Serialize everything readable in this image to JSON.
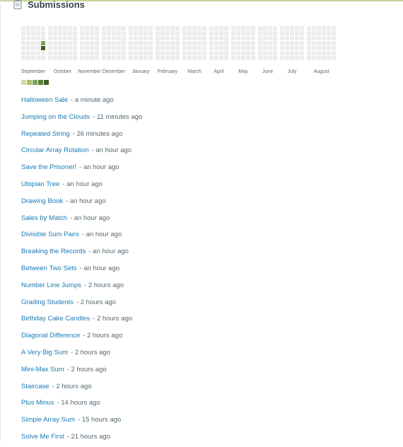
{
  "section": {
    "title": "Submissions",
    "icon": "clipboard-icon"
  },
  "heatmap": {
    "months": [
      "September",
      "October",
      "November",
      "December",
      "January",
      "February",
      "March",
      "April",
      "May",
      "June",
      "July",
      "August"
    ],
    "week_counts": [
      5,
      6,
      4,
      5,
      5,
      5,
      5,
      4,
      5,
      4,
      5,
      6
    ],
    "active_cells": [
      {
        "week": 4,
        "day": 3,
        "level": 2
      },
      {
        "week": 4,
        "day": 4,
        "level": 4
      }
    ],
    "empty_color": "#ececec",
    "levels": [
      "#d3dd9b",
      "#a6bf6b",
      "#7fa34f",
      "#5a7f35",
      "#3c5e24"
    ]
  },
  "submissions": [
    {
      "name": "Halloween Sale",
      "time": "- a minute ago"
    },
    {
      "name": "Jumping on the Clouds",
      "time": "- 11 minutes ago"
    },
    {
      "name": "Repeated String",
      "time": "- 26 minutes ago"
    },
    {
      "name": "Circular Array Rotation",
      "time": "- an hour ago"
    },
    {
      "name": "Save the Prisoner!",
      "time": "- an hour ago"
    },
    {
      "name": "Utopian Tree",
      "time": "- an hour ago"
    },
    {
      "name": "Drawing Book",
      "time": "- an hour ago"
    },
    {
      "name": "Sales by Match",
      "time": "- an hour ago"
    },
    {
      "name": "Divisible Sum Pairs",
      "time": "- an hour ago"
    },
    {
      "name": "Breaking the Records",
      "time": "- an hour ago"
    },
    {
      "name": "Between Two Sets",
      "time": "- an hour ago"
    },
    {
      "name": "Number Line Jumps",
      "time": "- 2 hours ago"
    },
    {
      "name": "Grading Students",
      "time": "- 2 hours ago"
    },
    {
      "name": "Birthday Cake Candles",
      "time": "- 2 hours ago"
    },
    {
      "name": "Diagonal Difference",
      "time": "- 2 hours ago"
    },
    {
      "name": "A Very Big Sum",
      "time": "- 2 hours ago"
    },
    {
      "name": "Mini-Max Sum",
      "time": "- 2 hours ago"
    },
    {
      "name": "Staircase",
      "time": "- 2 hours ago"
    },
    {
      "name": "Plus Minus",
      "time": "- 14 hours ago"
    },
    {
      "name": "Simple Array Sum",
      "time": "- 15 hours ago"
    },
    {
      "name": "Solve Me First",
      "time": "- 21 hours ago"
    }
  ]
}
